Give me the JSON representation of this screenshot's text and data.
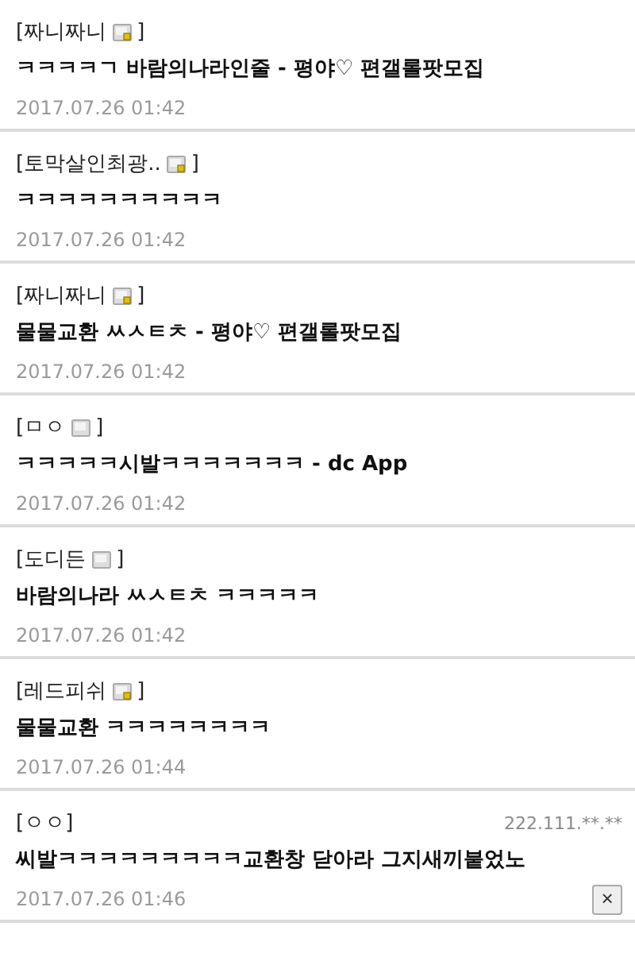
{
  "comments": [
    {
      "open": "[",
      "nick": "짜니짜니",
      "kind": "fixed",
      "close": "]",
      "text": "ㅋㅋㅋㅋㄱ 바람의나라인줄 - 평야♡ 편갤롤팟모집",
      "date": "2017.07.26 01:42"
    },
    {
      "open": "[",
      "nick": "토막살인최광..",
      "kind": "fixed",
      "close": "]",
      "text": "ㅋㅋㅋㅋㅋㅋㅋㅋㅋㅋ",
      "date": "2017.07.26 01:42"
    },
    {
      "open": "[",
      "nick": "짜니짜니",
      "kind": "fixed",
      "close": "]",
      "text": "물물교환 ㅆㅅㅌㅊ - 평야♡ 편갤롤팟모집",
      "date": "2017.07.26 01:42"
    },
    {
      "open": "[",
      "nick": "ㅁㅇ",
      "kind": "half",
      "close": "]",
      "text": "ㅋㅋㅋㅋㅋ시발ㅋㅋㅋㅋㅋㅋㅋ - dc App",
      "date": "2017.07.26 01:42"
    },
    {
      "open": "[",
      "nick": "도디든",
      "kind": "half",
      "close": "]",
      "text": "바람의나라 ㅆㅅㅌㅊ ㅋㅋㅋㅋㅋ",
      "date": "2017.07.26 01:42"
    },
    {
      "open": "[",
      "nick": "레드피쉬",
      "kind": "fixed",
      "close": "]",
      "text": "물물교환 ㅋㅋㅋㅋㅋㅋㅋㅋ",
      "date": "2017.07.26 01:44"
    },
    {
      "open": "[",
      "nick": "ㅇㅇ",
      "kind": "guest",
      "close": "]",
      "ip": "222.111.**.**",
      "text": "씨발ㅋㅋㅋㅋㅋㅋㅋㅋㅋ교환창 닫아라 그지새끼붙었노",
      "date": "2017.07.26 01:46",
      "delete": "×"
    }
  ]
}
